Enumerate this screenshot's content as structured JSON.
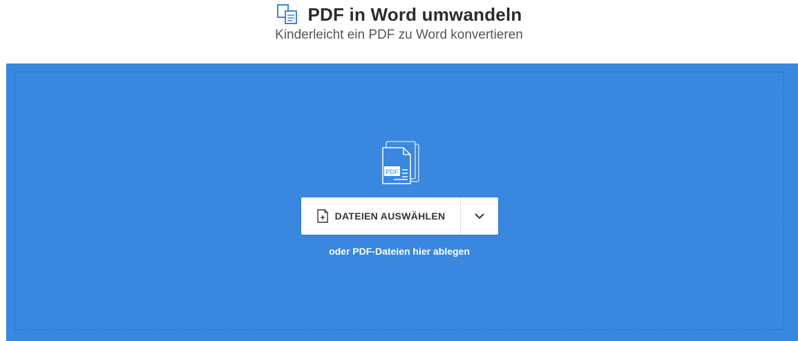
{
  "header": {
    "title": "PDF in Word umwandeln",
    "subtitle": "Kinderleicht ein PDF zu Word konvertieren",
    "icon": "pdf-to-word-icon",
    "icon_color": "#3b86d8"
  },
  "upload": {
    "background_color": "#3987df",
    "graphic_icon": "pdf-files-icon",
    "graphic_badge": "PDF",
    "choose_button_label": "DATEIEN AUSWÄHLEN",
    "choose_button_icon": "file-add-icon",
    "dropdown_icon": "chevron-down-icon",
    "drop_hint": "oder PDF-Dateien hier ablegen"
  }
}
